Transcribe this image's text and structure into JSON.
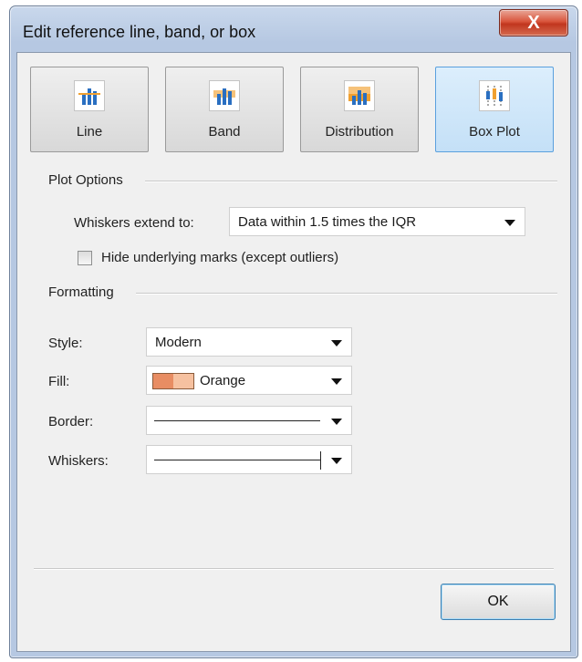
{
  "window": {
    "title": "Edit reference line, band, or box",
    "close_glyph": "X"
  },
  "tools": [
    {
      "label": "Line",
      "icon": "reference-line-icon",
      "selected": false
    },
    {
      "label": "Band",
      "icon": "reference-band-icon",
      "selected": false
    },
    {
      "label": "Distribution",
      "icon": "distribution-icon",
      "selected": false
    },
    {
      "label": "Box Plot",
      "icon": "box-plot-icon",
      "selected": true
    }
  ],
  "plot_options": {
    "heading": "Plot Options",
    "whiskers_label": "Whiskers extend to:",
    "whiskers_value": "Data within 1.5 times the IQR",
    "hide_marks_label": "Hide underlying marks (except outliers)",
    "hide_marks_checked": false
  },
  "formatting": {
    "heading": "Formatting",
    "style_label": "Style:",
    "style_value": "Modern",
    "fill_label": "Fill:",
    "fill_value": "Orange",
    "fill_colors": [
      "#e88d63",
      "#f6c1a0"
    ],
    "border_label": "Border:",
    "whiskers_label": "Whiskers:"
  },
  "footer": {
    "ok_label": "OK"
  },
  "colors": {
    "selected_tool": "#c4e0f7",
    "accent_orange": "#f0a030",
    "accent_blue": "#2a6fc1"
  }
}
